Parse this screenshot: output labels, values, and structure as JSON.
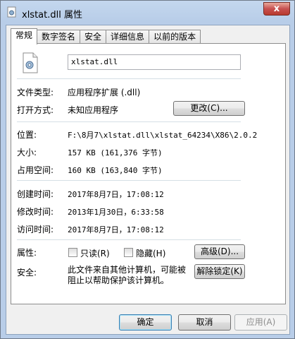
{
  "window": {
    "title": "xlstat.dll 属性",
    "close_glyph": "x"
  },
  "tabs": [
    {
      "label": "常规",
      "active": true
    },
    {
      "label": "数字签名",
      "active": false
    },
    {
      "label": "安全",
      "active": false
    },
    {
      "label": "详细信息",
      "active": false
    },
    {
      "label": "以前的版本",
      "active": false
    }
  ],
  "general": {
    "file_name": "xlstat.dll",
    "file_type_label": "文件类型:",
    "file_type_value": "应用程序扩展 (.dll)",
    "open_with_label": "打开方式:",
    "open_with_value": "未知应用程序",
    "change_button": "更改(C)...",
    "location_label": "位置:",
    "location_value": "F:\\8月7\\xlstat.dll\\xlstat_64234\\X86\\2.0.2",
    "size_label": "大小:",
    "size_value": "157 KB (161,376 字节)",
    "size_on_disk_label": "占用空间:",
    "size_on_disk_value": "160 KB (163,840 字节)",
    "created_label": "创建时间:",
    "created_value": "2017年8月7日，17:08:12",
    "modified_label": "修改时间:",
    "modified_value": "2013年1月30日，6:33:58",
    "accessed_label": "访问时间:",
    "accessed_value": "2017年8月7日，17:08:12",
    "attributes_label": "属性:",
    "readonly_label": "只读(R)",
    "hidden_label": "隐藏(H)",
    "advanced_button": "高级(D)...",
    "security_label": "安全:",
    "security_text": "此文件来自其他计算机，可能被阻止以帮助保护该计算机。",
    "unblock_button": "解除锁定(K)"
  },
  "footer": {
    "ok_button": "确定",
    "cancel_button": "取消",
    "apply_button": "应用(A)"
  },
  "colors": {
    "accent": "#3c7fb1",
    "close": "#c75050"
  }
}
